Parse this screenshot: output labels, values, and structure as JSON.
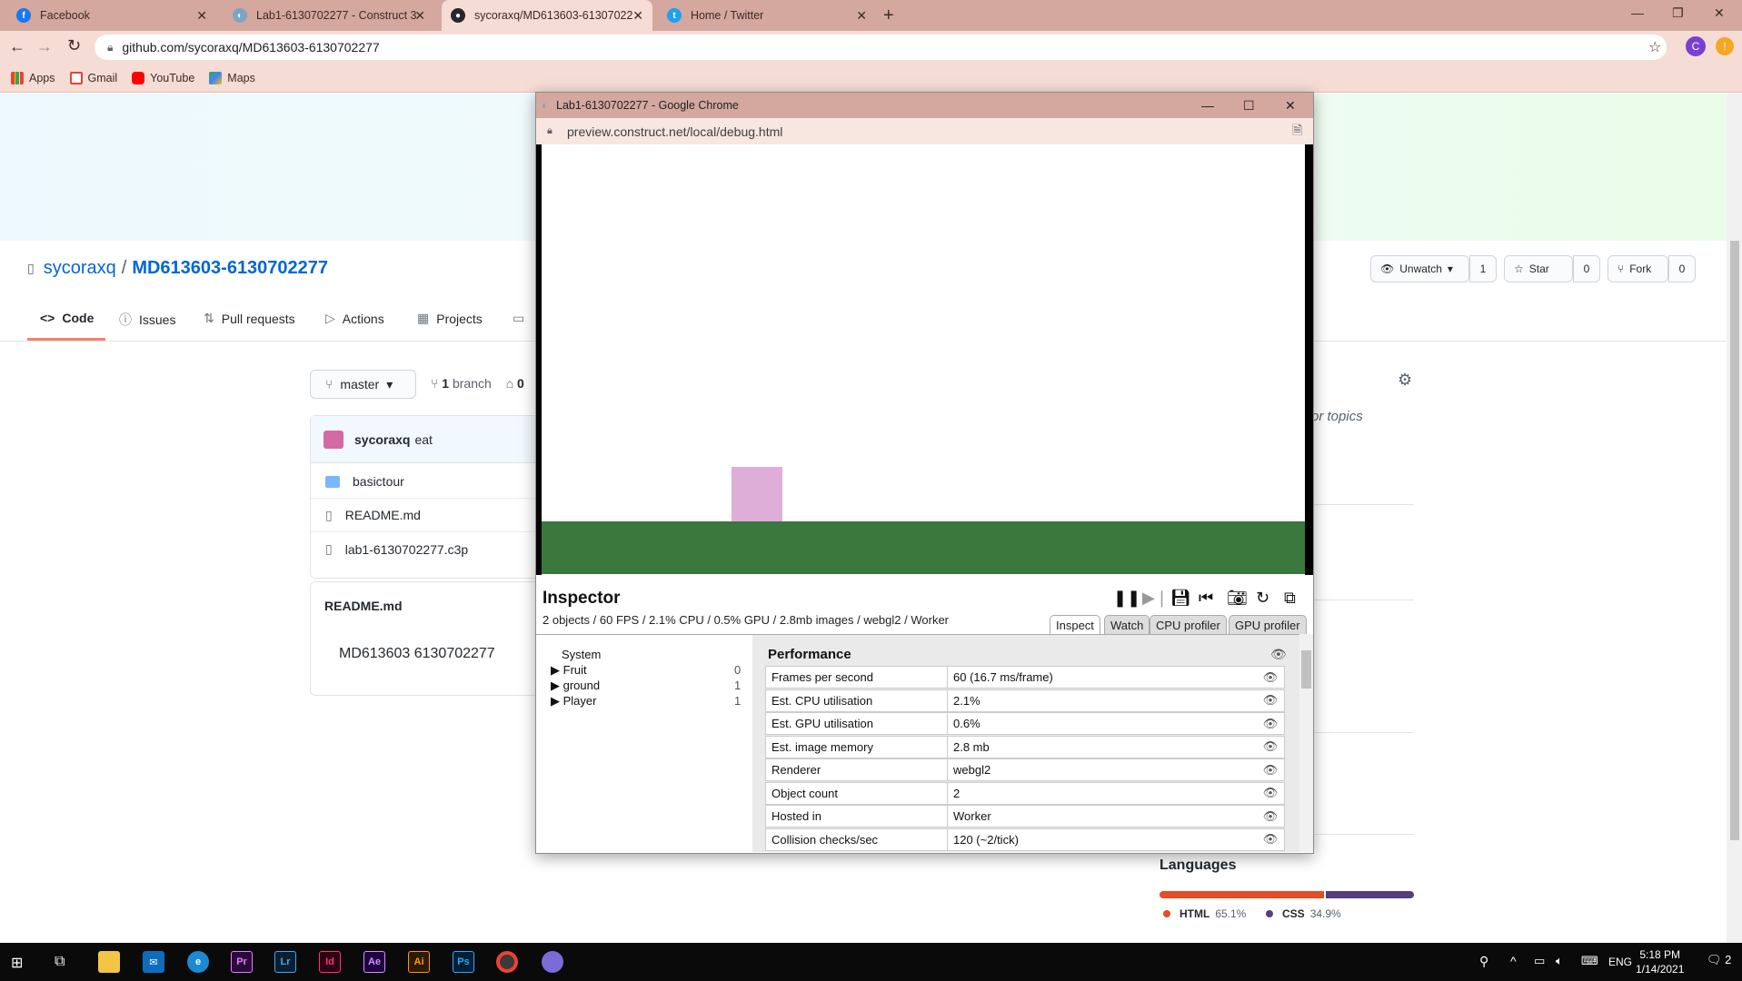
{
  "browser": {
    "tabs": [
      {
        "label": "Facebook",
        "icon": "facebook-icon"
      },
      {
        "label": "Lab1-6130702277 - Construct 3",
        "icon": "construct-icon"
      },
      {
        "label": "sycoraxq/MD613603-61307022",
        "icon": "github-icon"
      },
      {
        "label": "Home / Twitter",
        "icon": "twitter-icon"
      }
    ],
    "url": "github.com/sycoraxq/MD613603-6130702277",
    "profile_initial": "C",
    "bookmarks": [
      {
        "label": "Apps",
        "icon": "apps-grid-icon"
      },
      {
        "label": "Gmail",
        "icon": "gmail-icon"
      },
      {
        "label": "YouTube",
        "icon": "youtube-icon"
      },
      {
        "label": "Maps",
        "icon": "maps-icon"
      }
    ]
  },
  "repo": {
    "owner": "sycoraxq",
    "separator": "/",
    "name": "MD613603-6130702277",
    "watch_label": "Unwatch",
    "watch_count": "1",
    "star_label": "Star",
    "star_count": "0",
    "fork_label": "Fork",
    "fork_count": "0",
    "nav": [
      "Code",
      "Issues",
      "Pull requests",
      "Actions",
      "Projects"
    ],
    "branch": "master",
    "branch_count": "1",
    "branch_word": "branch",
    "tags_partial": "0",
    "commit_user": "sycoraxq",
    "commit_msg": "eat",
    "files": [
      "basictour",
      "README.md",
      "lab1-6130702277.c3p"
    ],
    "readme_title": "README.md",
    "readme_heading": "MD613603 6130702277",
    "topics_partial": "or topics",
    "languages_title": "Languages",
    "languages": [
      {
        "name": "HTML",
        "pct": "65.1%",
        "value": 65.1,
        "color": "#e34c26"
      },
      {
        "name": "CSS",
        "pct": "34.9%",
        "value": 34.9,
        "color": "#563d7c"
      }
    ]
  },
  "popup": {
    "title": "Lab1-6130702277 - Google Chrome",
    "url": "preview.construct.net/local/debug.html",
    "inspector_title": "Inspector",
    "stats": "2 objects / 60 FPS / 2.1% CPU / 0.5% GPU / 2.8mb images / webgl2 / Worker",
    "tabs": [
      "Inspect",
      "Watch",
      "CPU profiler",
      "GPU profiler"
    ],
    "tree": [
      {
        "label": "System",
        "count": ""
      },
      {
        "label": "Fruit",
        "count": "0"
      },
      {
        "label": "ground",
        "count": "1"
      },
      {
        "label": "Player",
        "count": "1"
      }
    ],
    "section": "Performance",
    "rows": [
      {
        "k": "Frames per second",
        "v": "60 (16.7 ms/frame)"
      },
      {
        "k": "Est. CPU utilisation",
        "v": "2.1%"
      },
      {
        "k": "Est. GPU utilisation",
        "v": "0.6%"
      },
      {
        "k": "Est. image memory",
        "v": "2.8 mb"
      },
      {
        "k": "Renderer",
        "v": "webgl2"
      },
      {
        "k": "Object count",
        "v": "2"
      },
      {
        "k": "Hosted in",
        "v": "Worker"
      },
      {
        "k": "Collision checks/sec",
        "v": "120 (~2/tick)"
      }
    ]
  },
  "taskbar": {
    "time": "5:18 PM",
    "date": "1/14/2021",
    "lang": "ENG",
    "notifications": "2"
  }
}
